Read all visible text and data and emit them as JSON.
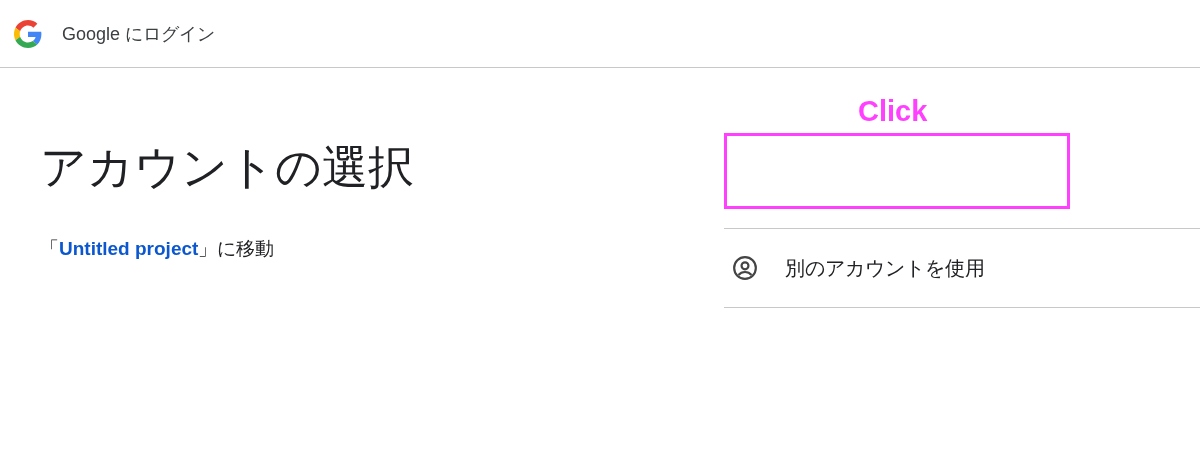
{
  "header": {
    "brand": "Google",
    "title": "にログイン"
  },
  "heading": "アカウントの選択",
  "subtitle": {
    "prefix": "「",
    "link": "Untitled project",
    "suffix": "」に移動"
  },
  "annotation": {
    "label": "Click"
  },
  "accounts": [
    {
      "kind": "hidden"
    },
    {
      "kind": "other",
      "label": "別のアカウントを使用"
    }
  ]
}
